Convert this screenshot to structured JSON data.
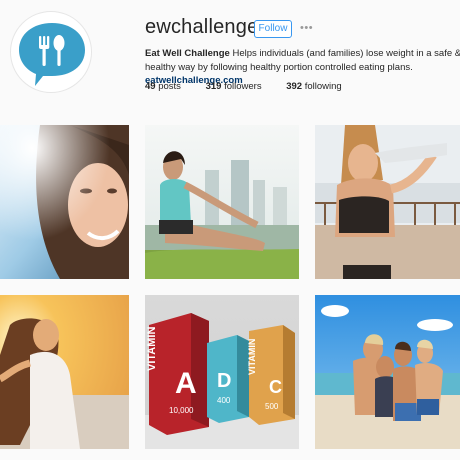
{
  "profile": {
    "username": "ewchallenge",
    "follow_label": "Follow",
    "more_label": "•••",
    "display_name": "Eat Well Challenge",
    "bio_text": "Helps individuals (and families) lose weight in a safe & healthy way by following healthy portion controlled eating plans.",
    "link": "eatwellchallenge.com"
  },
  "stats": {
    "posts_count": "49",
    "posts_label": "posts",
    "followers_count": "319",
    "followers_label": "followers",
    "following_count": "392",
    "following_label": "following"
  },
  "colors": {
    "accent": "#3897f0",
    "avatar_bubble": "#3a9fc9",
    "link": "#003569"
  },
  "posts": [
    {
      "icon": "smiling-woman-portrait-photo"
    },
    {
      "icon": "woman-stretching-on-grass-photo"
    },
    {
      "icon": "woman-with-towel-photo"
    },
    {
      "icon": "woman-in-sunlight-photo"
    },
    {
      "icon": "vitamin-boxes-photo",
      "box_labels": [
        "VITAMIN",
        "A",
        "10,000",
        "D",
        "400",
        "VITAMIN",
        "C",
        "500"
      ]
    },
    {
      "icon": "family-on-beach-photo"
    }
  ]
}
